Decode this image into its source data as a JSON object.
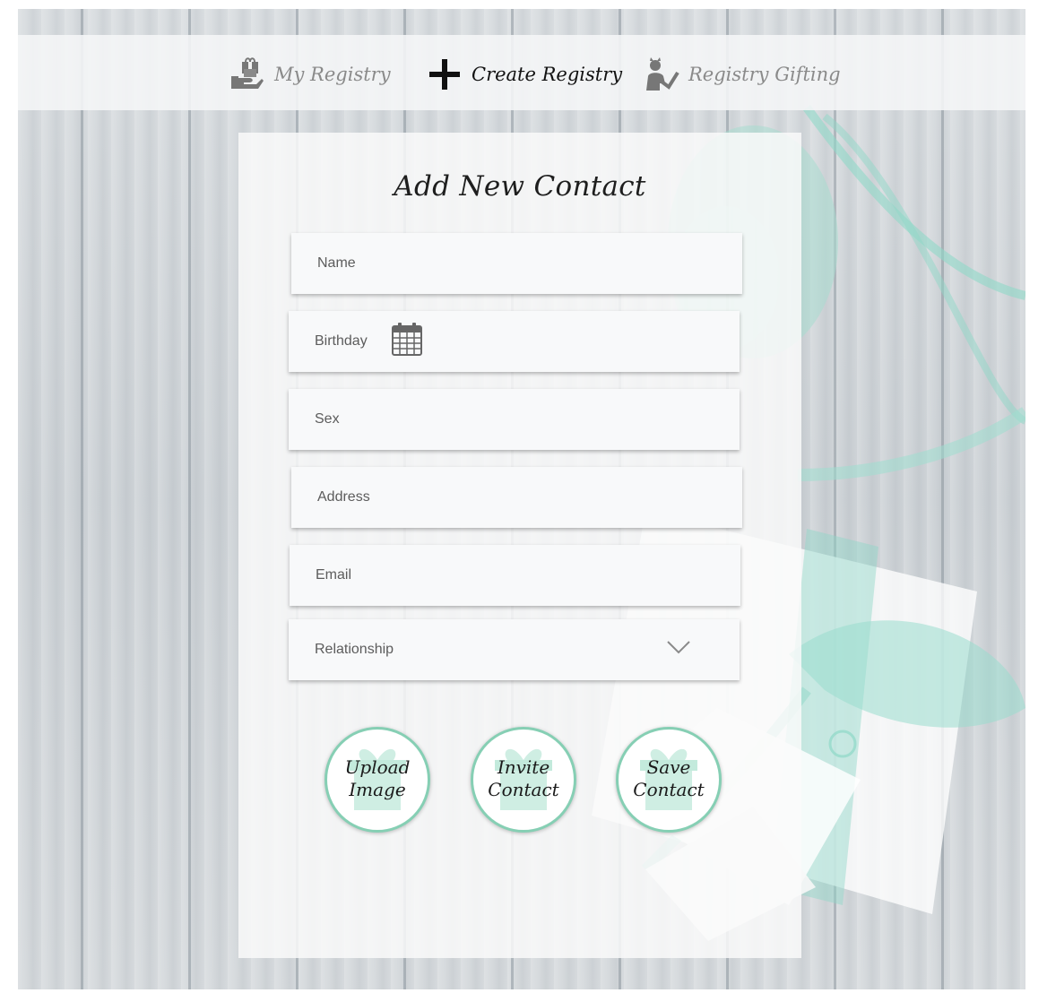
{
  "nav": {
    "my_registry": "My Registry",
    "create_registry": "Create Registry",
    "registry_gifting": "Registry Gifting"
  },
  "form": {
    "title": "Add New Contact",
    "name_label": "Name",
    "birthday_label": "Birthday",
    "sex_label": "Sex",
    "address_label": "Address",
    "email_label": "Email",
    "relationship_label": "Relationship"
  },
  "buttons": {
    "upload_line1": "Upload",
    "upload_line2": "Image",
    "invite_line1": "Invite",
    "invite_line2": "Contact",
    "save_line1": "Save",
    "save_line2": "Contact"
  },
  "icons": {
    "my_registry": "gift-hand-icon",
    "create_registry": "plus-icon",
    "registry_gifting": "gift-person-icon",
    "birthday": "calendar-icon",
    "relationship": "chevron-down-icon"
  },
  "colors": {
    "accent": "#86cfb4",
    "ribbon": "#8fd8c8",
    "nav_active": "#111111",
    "nav_inactive": "#8a8a8a"
  }
}
